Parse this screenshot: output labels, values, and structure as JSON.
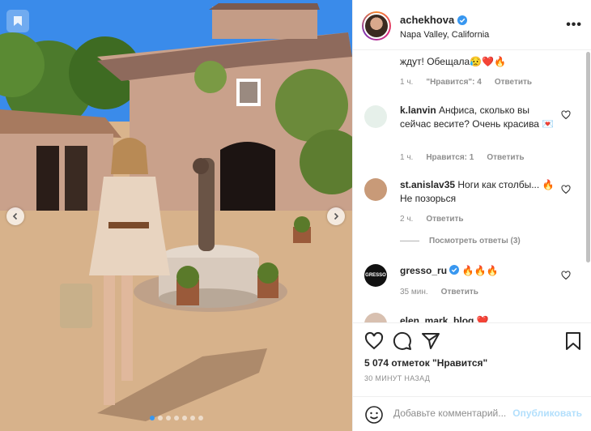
{
  "post": {
    "username": "achekhova",
    "location": "Napa Valley, California",
    "more_icon": "more-horizontal-icon"
  },
  "comments": [
    {
      "text": "ждут! Обещала😥❤️🔥",
      "time": "1 ч.",
      "likes": "\"Нравится\": 4",
      "reply": "Ответить"
    },
    {
      "username": "k.lanvin",
      "text": "Анфиса, сколько вы сейчас весите? Очень красива 💌",
      "time": "1 ч.",
      "likes": "Нравится: 1",
      "reply": "Ответить"
    },
    {
      "username": "st.anislav35",
      "text": "Ноги как столбы... 🔥 Не позорься",
      "time": "2 ч.",
      "reply": "Ответить"
    },
    {
      "username": "gresso_ru",
      "text": "🔥🔥🔥",
      "time": "35 мин.",
      "reply": "Ответить"
    },
    {
      "username": "elen_mark_blog",
      "text": "❤️"
    }
  ],
  "view_replies": "Посмотреть ответы (3)",
  "likes_text": "5 074 отметок \"Нравится\"",
  "time_ago": "30 МИНУТ НАЗАД",
  "comment_placeholder": "Добавьте комментарий...",
  "publish_label": "Опубликовать",
  "carousel": {
    "count": 7,
    "active_index": 0
  },
  "colors": {
    "accent": "#3897f0",
    "publish_disabled": "#b2dffc",
    "muted": "#8e8e8e"
  }
}
